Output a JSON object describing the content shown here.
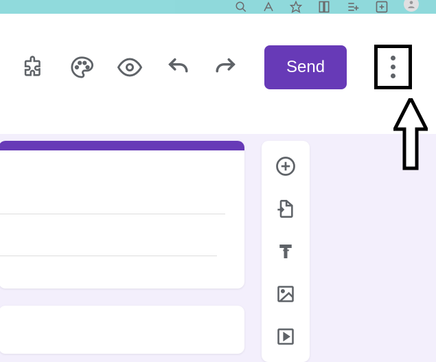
{
  "colors": {
    "accent": "#673ab7",
    "icon": "#5f6368",
    "browserBar": "#7ed6d6",
    "canvas": "#f3effc"
  },
  "browserBar": {
    "icons": [
      "zoom",
      "text-size",
      "star",
      "reader",
      "list",
      "new-tab",
      "profile"
    ]
  },
  "toolbar": {
    "addons_label": "Add-ons",
    "theme_label": "Customize theme",
    "preview_label": "Preview",
    "undo_label": "Undo",
    "redo_label": "Redo",
    "send_label": "Send",
    "more_label": "More"
  },
  "annotation": {
    "highlight_target": "more-menu"
  },
  "sideToolbar": {
    "items": [
      {
        "name": "add-question",
        "label": "Add question"
      },
      {
        "name": "import-questions",
        "label": "Import questions"
      },
      {
        "name": "add-title",
        "label": "Add title and description"
      },
      {
        "name": "add-image",
        "label": "Add image"
      },
      {
        "name": "add-video",
        "label": "Add video"
      }
    ]
  },
  "formCard": {
    "title": "",
    "description": ""
  }
}
